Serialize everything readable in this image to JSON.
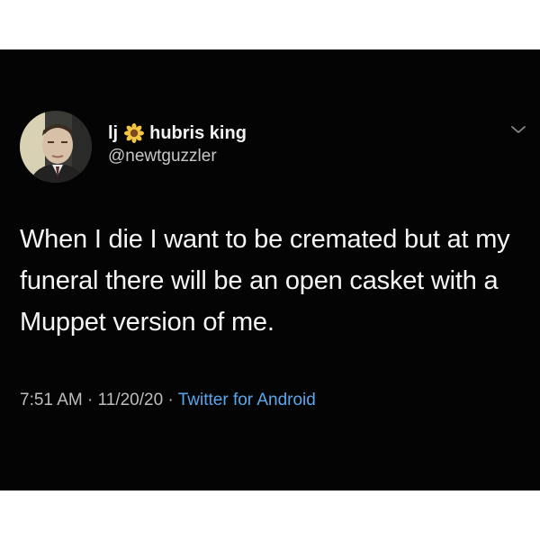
{
  "tweet": {
    "display_name_prefix": "lj",
    "display_name": "hubris king",
    "handle": "@newtguzzler",
    "text": "When I die I want to be cremated but at my funeral there will be an open casket with a Muppet version of me.",
    "time": "7:51 AM",
    "separator": " · ",
    "date": "11/20/20",
    "source": "Twitter for Android"
  },
  "icons": {
    "name_emoji": "sunflower-icon",
    "menu": "chevron-down-icon"
  },
  "colors": {
    "background": "#040404",
    "text": "#f5f5f5",
    "secondary": "#bdbdbd",
    "link": "#5aa7ee"
  }
}
